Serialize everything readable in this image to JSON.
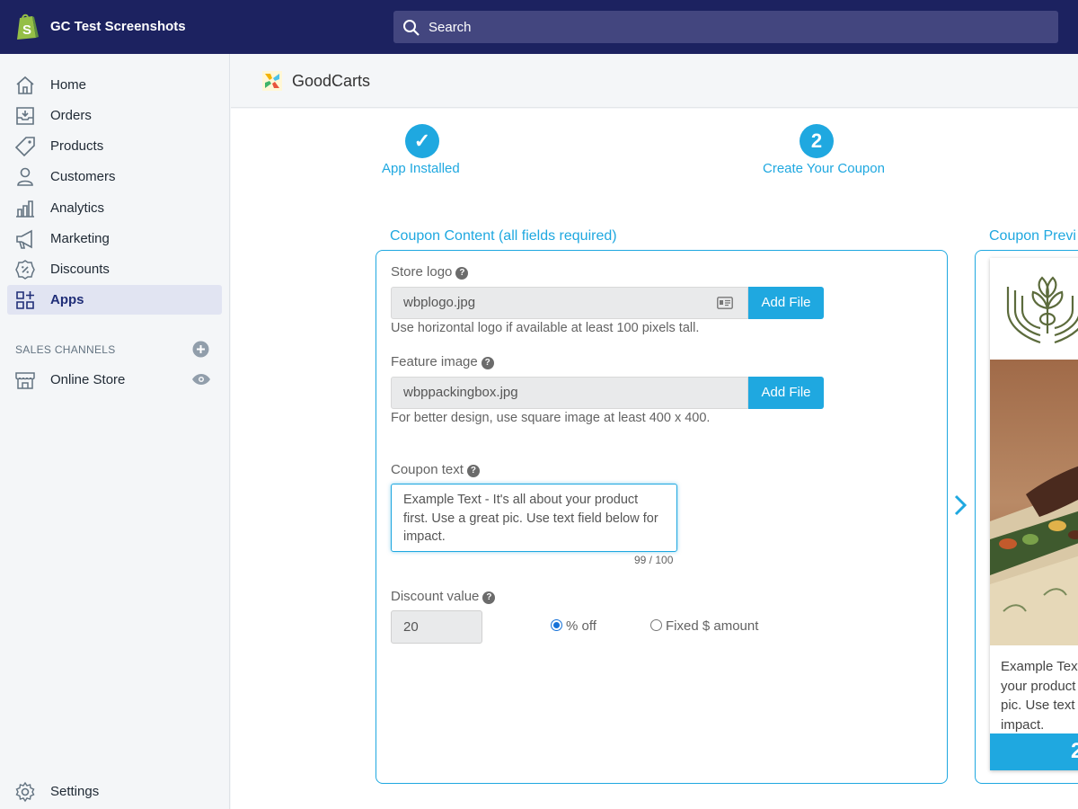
{
  "topbar": {
    "store_name": "GC Test Screenshots",
    "search_placeholder": "Search"
  },
  "sidebar": {
    "items": [
      {
        "label": "Home",
        "icon": "home-icon"
      },
      {
        "label": "Orders",
        "icon": "orders-icon"
      },
      {
        "label": "Products",
        "icon": "tag-icon"
      },
      {
        "label": "Customers",
        "icon": "person-icon"
      },
      {
        "label": "Analytics",
        "icon": "bar-chart-icon"
      },
      {
        "label": "Marketing",
        "icon": "megaphone-icon"
      },
      {
        "label": "Discounts",
        "icon": "discount-icon"
      },
      {
        "label": "Apps",
        "icon": "apps-icon",
        "active": true
      }
    ],
    "sales_channels_heading": "SALES CHANNELS",
    "online_store_label": "Online Store",
    "settings_label": "Settings"
  },
  "app_header": {
    "app_name": "GoodCarts"
  },
  "steps": [
    {
      "label": "App Installed",
      "marker": "✓"
    },
    {
      "label": "Create Your Coupon",
      "marker": "2"
    }
  ],
  "coupon_content": {
    "title": "Coupon Content (all fields required)",
    "store_logo": {
      "label": "Store logo",
      "file_name": "wbplogo.jpg",
      "button": "Add File",
      "hint": "Use horizontal logo if available at least 100 pixels tall."
    },
    "feature_image": {
      "label": "Feature image",
      "file_name": "wbppackingbox.jpg",
      "button": "Add File",
      "hint": "For better design, use square image at least 400 x 400."
    },
    "coupon_text": {
      "label": "Coupon text",
      "value": "Example Text - It's all about your product first. Use a great pic. Use text field below for impact.",
      "counter": "99 / 100"
    },
    "discount": {
      "label": "Discount value",
      "value": "20",
      "options": [
        {
          "label": "% off",
          "selected": true
        },
        {
          "label": "Fixed $ amount",
          "selected": false
        }
      ]
    }
  },
  "preview": {
    "title": "Coupon Previ",
    "text": "Example Text - It's all about your product first. Use a great pic. Use text field below for impact.",
    "bar_text": "2"
  },
  "colors": {
    "topbar": "#1c2260",
    "accent": "#1fa8e0",
    "sidebar_bg": "#f4f6f8",
    "active_nav": "#e1e4f2"
  }
}
